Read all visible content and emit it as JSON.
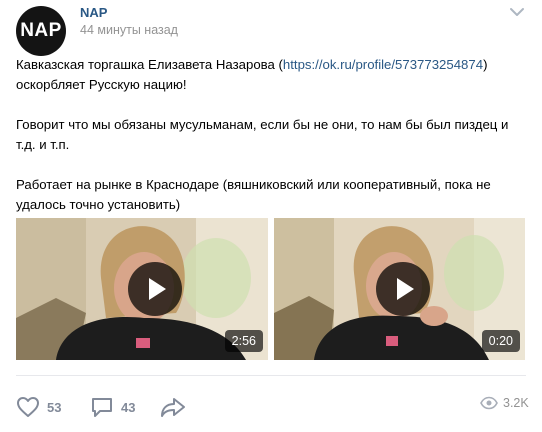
{
  "post": {
    "author": "NAP",
    "avatar_text": "NAP",
    "time": "44 минуты назад",
    "text": {
      "p1_before": "Кавказская торгашка Елизавета Назарова (",
      "p1_link": "https://ok.ru/profile/573773254874",
      "p1_after": ")",
      "p1_line2": "оскорбляет Русскую нацию!",
      "p2_line1": "Говорит что мы обязаны мусульманам, если бы не они, то нам бы был пиздец и",
      "p2_line2": "т.д. и т.п.",
      "p3_line1": "Работает на рынке в Краснодаре (вяшниковский или кооперативный, пока не",
      "p3_line2": "удалось точно установить)"
    },
    "videos": [
      {
        "duration": "2:56"
      },
      {
        "duration": "0:20"
      }
    ]
  },
  "actions": {
    "likes": "53",
    "comments": "43",
    "views": "3.2K"
  },
  "colors": {
    "link": "#2a5885",
    "meta": "#939393",
    "action_gray": "#828a99"
  },
  "icons": [
    "chevron-down-icon",
    "play-icon",
    "heart-icon",
    "comment-icon",
    "share-icon",
    "eye-icon"
  ]
}
